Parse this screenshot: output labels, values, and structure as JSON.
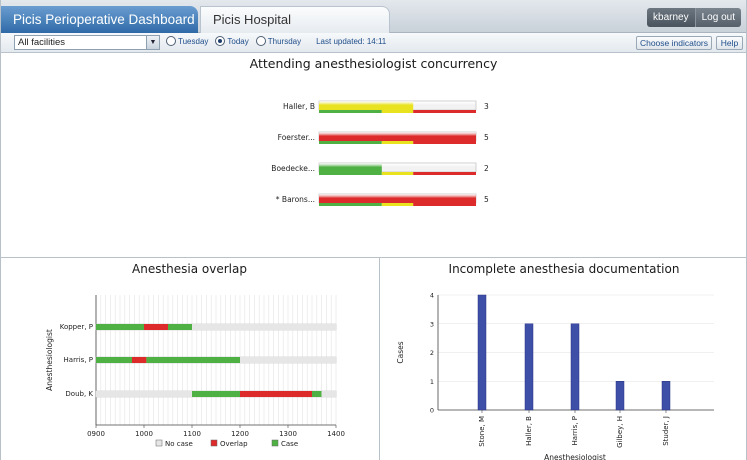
{
  "header": {
    "app_title": "Picis Perioperative Dashboard",
    "hospital": "Picis Hospital",
    "username": "kbarney",
    "logout_label": "Log out"
  },
  "toolbar": {
    "facility": "All facilities",
    "radios": [
      {
        "label": "Tuesday",
        "checked": false
      },
      {
        "label": "Today",
        "checked": true
      },
      {
        "label": "Thursday",
        "checked": false
      }
    ],
    "last_updated": "Last updated: 14:11",
    "choose_indicators_label": "Choose indicators",
    "help_label": "Help"
  },
  "colors": {
    "green": "#4fb043",
    "yellow": "#e8e21f",
    "red": "#dd2a2a",
    "gray_bar": "#e6e6e6",
    "bar_blue": "#3e4fa8"
  },
  "chart_data": [
    {
      "type": "bar",
      "title": "Attending anesthesiologist concurrency",
      "categories": [
        "Haller, B",
        "Foerster...",
        "Boedecke...",
        "* Barons..."
      ],
      "values": [
        3,
        5,
        2,
        5
      ],
      "max": 5,
      "scale_segments": [
        {
          "color": "green",
          "upto": 2
        },
        {
          "color": "yellow",
          "upto": 3
        },
        {
          "color": "red",
          "upto": 5
        }
      ]
    },
    {
      "type": "bar",
      "title": "Anesthesia overlap",
      "ylabel": "Anesthesiologist",
      "x_ticks": [
        "0900",
        "1000",
        "1100",
        "1200",
        "1300",
        "1400"
      ],
      "x_range": [
        900,
        1400
      ],
      "legend": [
        "No case",
        "Overlap",
        "Case"
      ],
      "legend_position": "bottom",
      "rows": [
        {
          "name": "Kopper, P",
          "segments": [
            {
              "start": 900,
              "end": 1000,
              "status": "Case"
            },
            {
              "start": 1000,
              "end": 1050,
              "status": "Overlap"
            },
            {
              "start": 1050,
              "end": 1100,
              "status": "Case"
            },
            {
              "start": 1100,
              "end": 1400,
              "status": "No case"
            }
          ]
        },
        {
          "name": "Harris, P",
          "segments": [
            {
              "start": 900,
              "end": 975,
              "status": "Case"
            },
            {
              "start": 975,
              "end": 1005,
              "status": "Overlap"
            },
            {
              "start": 1005,
              "end": 1200,
              "status": "Case"
            },
            {
              "start": 1200,
              "end": 1400,
              "status": "No case"
            }
          ]
        },
        {
          "name": "Doub, K",
          "segments": [
            {
              "start": 900,
              "end": 1100,
              "status": "No case"
            },
            {
              "start": 1100,
              "end": 1200,
              "status": "Case"
            },
            {
              "start": 1200,
              "end": 1350,
              "status": "Overlap"
            },
            {
              "start": 1350,
              "end": 1370,
              "status": "Case"
            },
            {
              "start": 1370,
              "end": 1400,
              "status": "No case"
            }
          ]
        }
      ]
    },
    {
      "type": "bar",
      "title": "Incomplete anesthesia documentation",
      "xlabel": "Anesthesiologist",
      "ylabel": "Cases",
      "ylim": [
        0,
        4
      ],
      "categories": [
        "Stone, M",
        "Haller, B",
        "Harris, P",
        "Gilbey, H",
        "Studer, J"
      ],
      "values": [
        4,
        3,
        3,
        1,
        1
      ]
    }
  ]
}
